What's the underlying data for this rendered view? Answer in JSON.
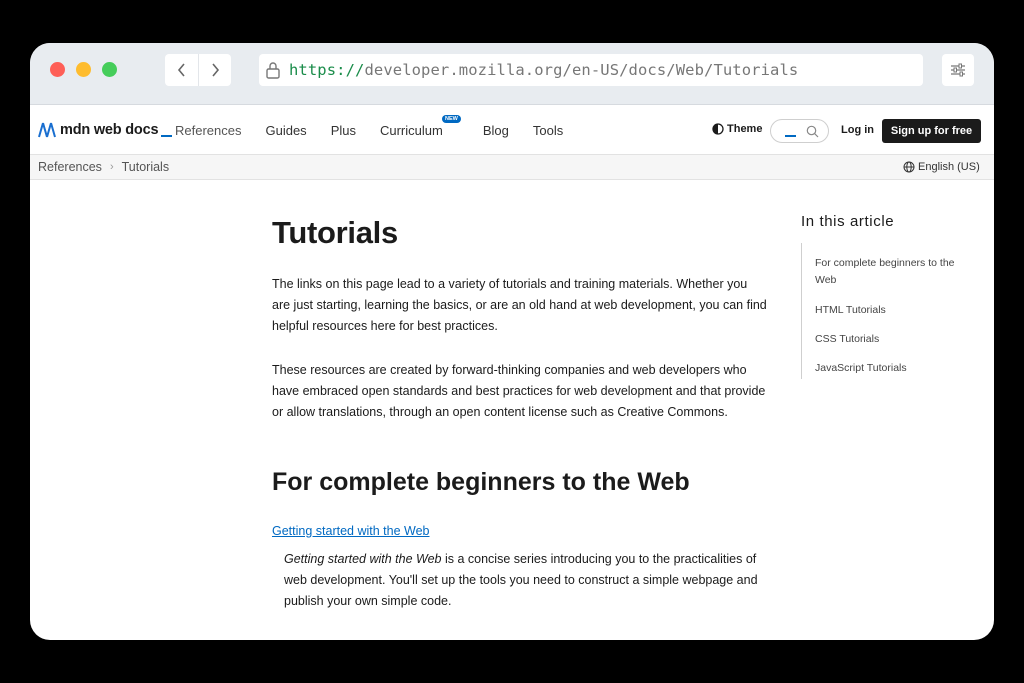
{
  "browser": {
    "url_scheme": "https://",
    "url_rest": "developer.mozilla.org/en-US/docs/Web/Tutorials"
  },
  "header": {
    "logo_text": "mdn web docs",
    "nav": [
      "References",
      "Guides",
      "Plus",
      "Curriculum",
      "Blog",
      "Tools"
    ],
    "new_badge": "NEW",
    "theme_label": "Theme",
    "login_label": "Log in",
    "signup_label": "Sign up for free"
  },
  "breadcrumb": {
    "items": [
      "References",
      "Tutorials"
    ],
    "language": "English (US)"
  },
  "article": {
    "title": "Tutorials",
    "paragraphs": [
      "The links on this page lead to a variety of tutorials and training materials. Whether you are just starting, learning the basics, or are an old hand at web development, you can find helpful resources here for best practices.",
      "These resources are created by forward-thinking companies and web developers who have embraced open standards and best practices for web development and that provide or allow translations, through an open content license such as Creative Commons."
    ],
    "section_heading": "For complete beginners to the Web",
    "link_text": "Getting started with the Web",
    "desc_italic": "Getting started with the Web",
    "desc_rest": " is a concise series introducing you to the practicalities of web development. You'll set up the tools you need to construct a simple webpage and publish your own simple code."
  },
  "toc": {
    "title": "In this article",
    "items": [
      "For complete beginners to the Web",
      "HTML Tutorials",
      "CSS Tutorials",
      "JavaScript Tutorials"
    ]
  },
  "colors": {
    "accent": "#0069c2",
    "url_scheme": "#1a8c4a",
    "traffic_red": "#fe5f57",
    "traffic_yellow": "#febc2e",
    "traffic_green": "#28c840"
  },
  "icons": [
    "lock-icon",
    "back-icon",
    "forward-icon",
    "settings-icon",
    "mdn-logo-icon",
    "theme-icon",
    "search-icon",
    "globe-icon",
    "chevron-right-icon"
  ]
}
